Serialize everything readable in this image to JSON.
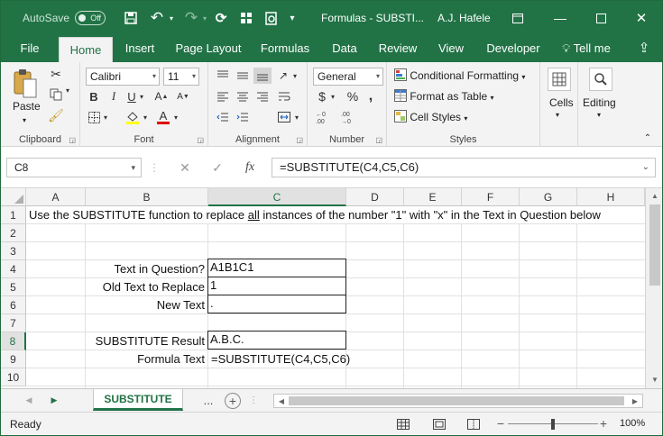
{
  "titlebar": {
    "autosave": "AutoSave",
    "toggle": "Off",
    "title": "Formulas - SUBSTI...",
    "user": "A.J. Hafele"
  },
  "tabs": [
    "File",
    "Home",
    "Insert",
    "Page Layout",
    "Formulas",
    "Data",
    "Review",
    "View",
    "Developer",
    "Tell me"
  ],
  "ribbon": {
    "clipboard": {
      "label": "Clipboard",
      "paste": "Paste"
    },
    "font": {
      "label": "Font",
      "name": "Calibri",
      "size": "11",
      "bold": "B",
      "italic": "I",
      "underline": "U"
    },
    "alignment": {
      "label": "Alignment"
    },
    "number": {
      "label": "Number",
      "format": "General",
      "currency": "$",
      "percent": "%",
      "comma": ","
    },
    "styles": {
      "label": "Styles",
      "cond": "Conditional Formatting",
      "table": "Format as Table",
      "cell": "Cell Styles"
    },
    "cells": {
      "label": "Cells"
    },
    "editing": {
      "label": "Editing"
    }
  },
  "formula_bar": {
    "namebox": "C8",
    "formula": "=SUBSTITUTE(C4,C5,C6)",
    "fx": "fx"
  },
  "columns": [
    "A",
    "B",
    "C",
    "D",
    "E",
    "F",
    "G",
    "H"
  ],
  "rows": [
    "1",
    "2",
    "3",
    "4",
    "5",
    "6",
    "7",
    "8",
    "9",
    "10"
  ],
  "cells": {
    "a1_before": "Use the SUBSTITUTE function to replace ",
    "a1_under": "all",
    "a1_after": " instances of the number \"1\" with \"x\" in the Text in Question below",
    "b4": "Text in Question?",
    "c4": "A1B1C1",
    "b5": "Old Text to Replace",
    "c5": "1",
    "b6": "New Text",
    "c6": ".",
    "b8": "SUBSTITUTE Result",
    "c8": "A.B.C.",
    "b9": "Formula Text",
    "c9": "=SUBSTITUTE(C4,C5,C6)"
  },
  "sheets": {
    "active": "SUBSTITUTE",
    "more": "..."
  },
  "status": {
    "ready": "Ready",
    "zoom": "100%"
  }
}
